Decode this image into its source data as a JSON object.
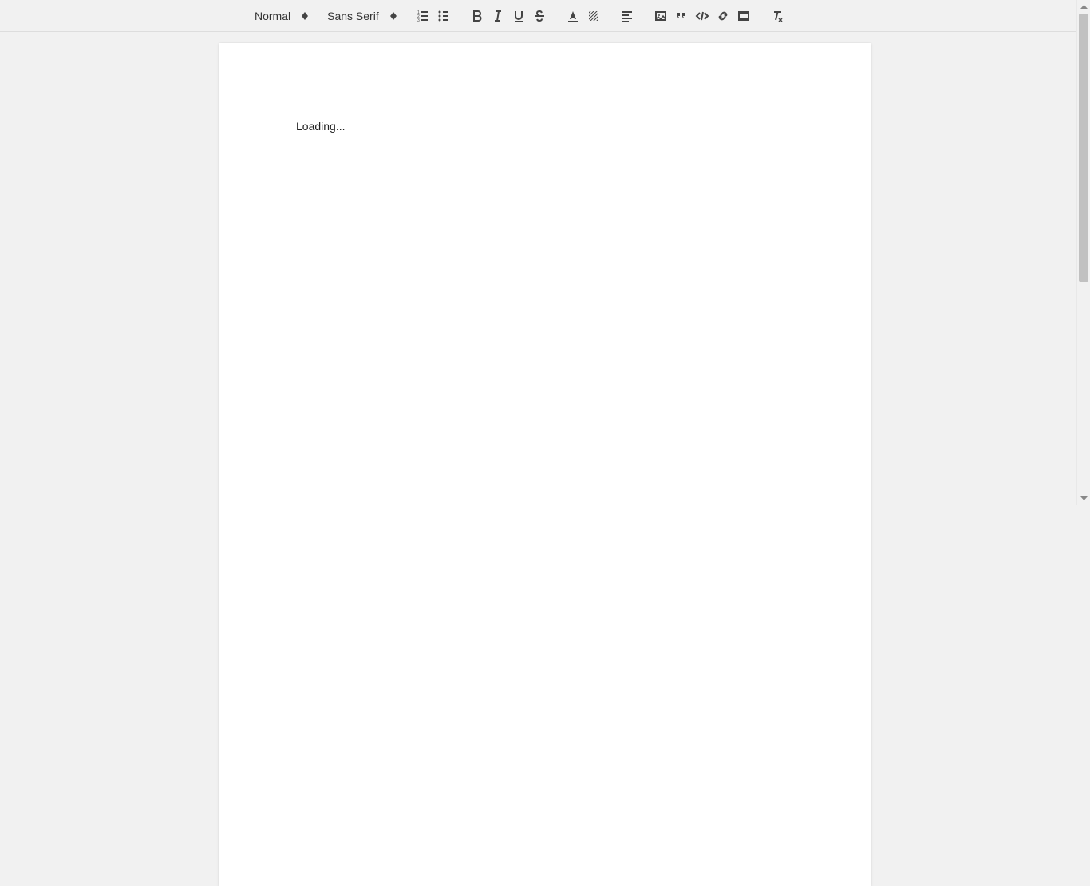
{
  "toolbar": {
    "heading_picker": {
      "label": "Normal"
    },
    "font_picker": {
      "label": "Sans Serif"
    }
  },
  "editor": {
    "content": "Loading..."
  }
}
